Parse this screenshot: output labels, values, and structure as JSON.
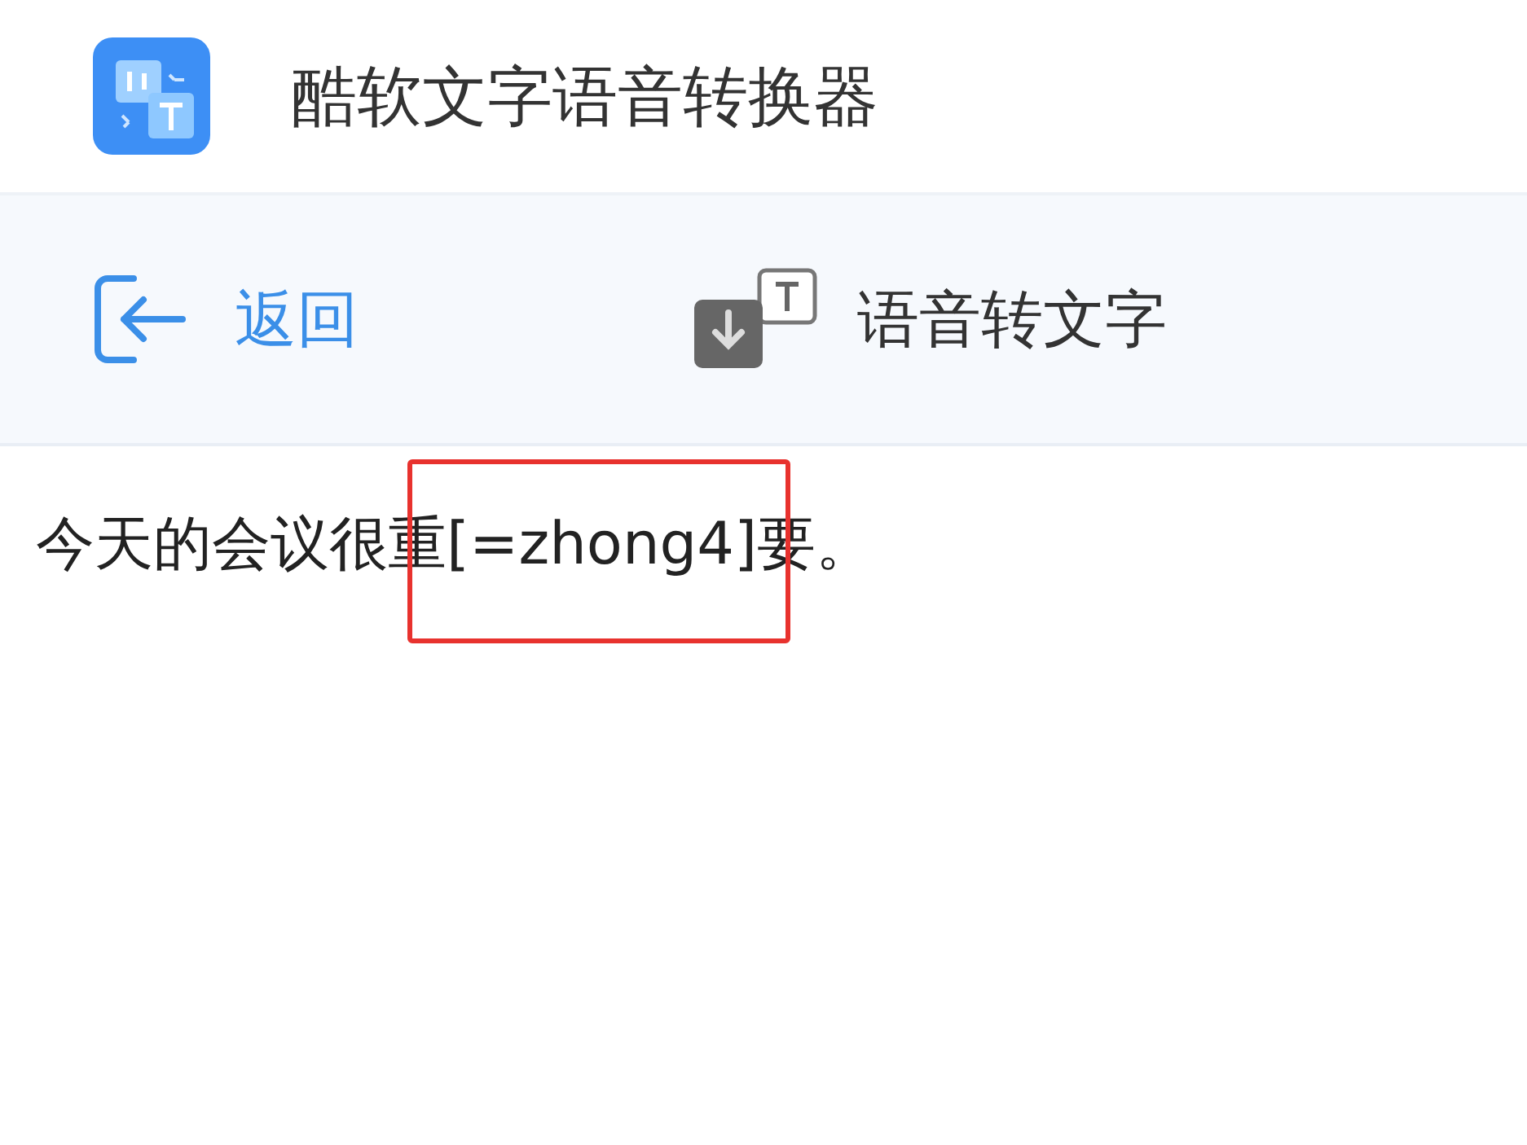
{
  "app": {
    "title": "酷软文字语音转换器"
  },
  "toolbar": {
    "back": "返回",
    "mode": "语音转文字"
  },
  "transcript": {
    "before": "今天的会议很重",
    "highlighted": "[=zhong4]",
    "after": "要。"
  }
}
